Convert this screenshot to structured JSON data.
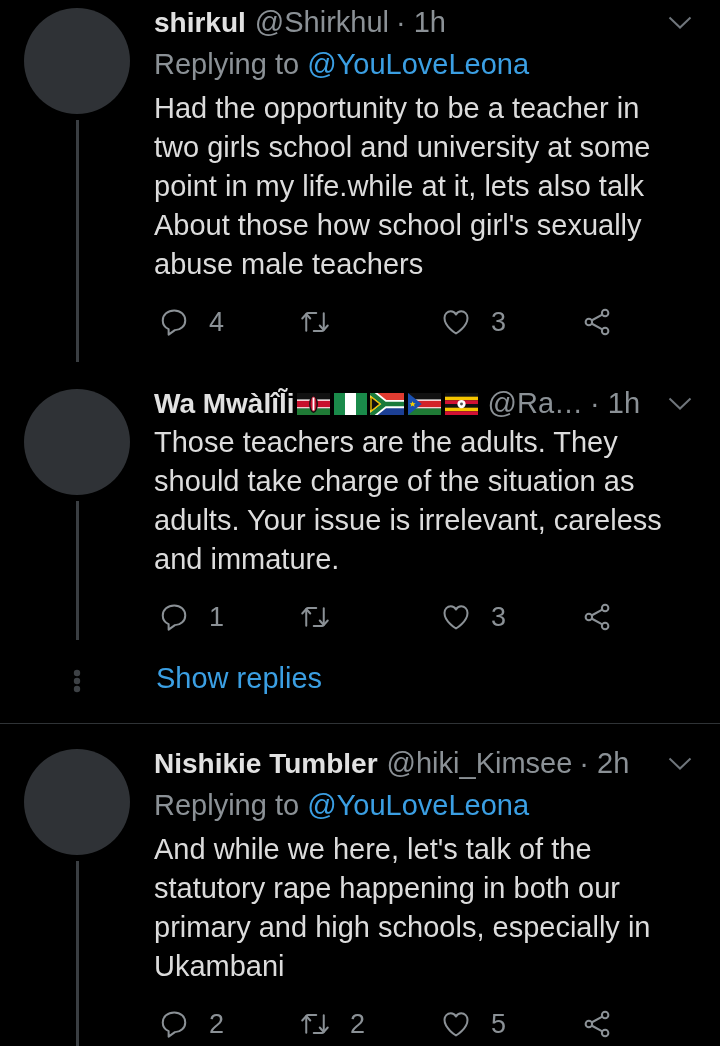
{
  "threads": [
    {
      "tweets": [
        {
          "name": "shirkul",
          "handle": "@Shirkhul",
          "time": "· 1h",
          "replying_to": {
            "prefix": "Replying to",
            "handle": "@YouLoveLeona"
          },
          "text": "Had the opportunity to be a teacher in two girls school and university at some point in my life.while at it, lets also talk About those how school girl's sexually abuse male teachers",
          "thread_line": true,
          "actions": [
            {
              "kind": "reply",
              "count": "4"
            },
            {
              "kind": "retweet"
            },
            {
              "kind": "like",
              "count": "3"
            },
            {
              "kind": "share"
            }
          ]
        },
        {
          "name": "Wa Mwàlîl̃i",
          "flags": [
            {
              "kind": "kenya"
            },
            {
              "kind": "nigeria"
            },
            {
              "kind": "southafrica"
            },
            {
              "kind": "southsudan"
            },
            {
              "kind": "uganda"
            }
          ],
          "handle": "@Ra…",
          "time": "· 1h",
          "text": "Those teachers are the adults. They should take charge of the situation as adults. Your issue is irrelevant, careless and immature.",
          "thread_line": true,
          "actions": [
            {
              "kind": "reply",
              "count": "1"
            },
            {
              "kind": "retweet"
            },
            {
              "kind": "like",
              "count": "3"
            },
            {
              "kind": "share"
            }
          ]
        }
      ],
      "show_replies": "Show replies"
    },
    {
      "tweets": [
        {
          "name": "Nishikie Tumbler",
          "handle": "@hiki_Kimsee",
          "time": "· 2h",
          "replying_to": {
            "prefix": "Replying to",
            "handle": "@YouLoveLeona"
          },
          "text": "And while we here, let's talk of the statutory rape happening in both our primary and high schools, especially in Ukambani",
          "thread_line": true,
          "actions": [
            {
              "kind": "reply",
              "count": "2"
            },
            {
              "kind": "retweet",
              "count": "2"
            },
            {
              "kind": "like",
              "count": "5"
            },
            {
              "kind": "share"
            }
          ]
        }
      ]
    }
  ]
}
